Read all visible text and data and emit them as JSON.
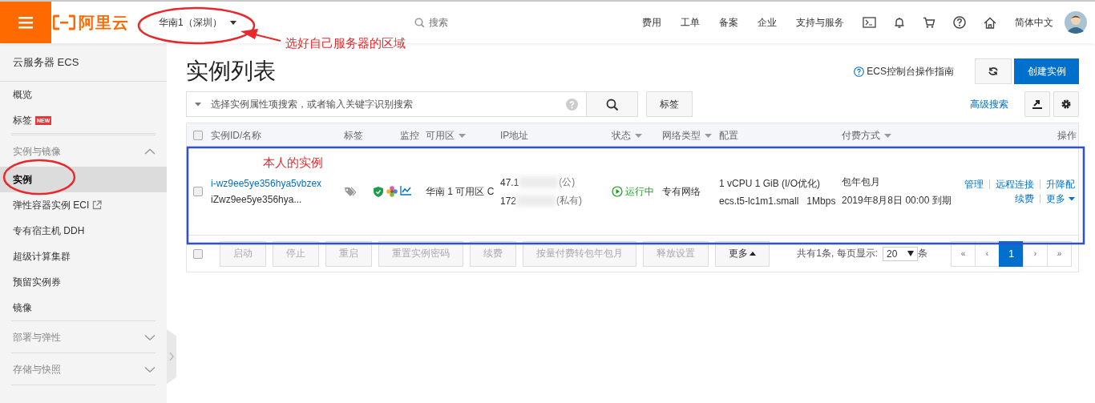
{
  "top_bar": {
    "logo_text": "阿里云",
    "region": "华南1（深圳）",
    "search_placeholder": "搜索",
    "nav_links": [
      "费用",
      "工单",
      "备案",
      "企业",
      "支持与服务"
    ],
    "language": "简体中文"
  },
  "sidebar": {
    "title": "云服务器 ECS",
    "items": [
      {
        "kind": "link",
        "label": "概览",
        "selected": false
      },
      {
        "kind": "link",
        "label": "标签",
        "selected": false,
        "badge": "NEW"
      },
      {
        "kind": "group",
        "label": "实例与镜像",
        "expanded": true
      },
      {
        "kind": "link",
        "label": "实例",
        "selected": true
      },
      {
        "kind": "link",
        "label": "弹性容器实例 ECI",
        "selected": false,
        "external": true
      },
      {
        "kind": "link",
        "label": "专有宿主机 DDH",
        "selected": false
      },
      {
        "kind": "link",
        "label": "超级计算集群",
        "selected": false
      },
      {
        "kind": "link",
        "label": "预留实例券",
        "selected": false
      },
      {
        "kind": "link",
        "label": "镜像",
        "selected": false
      },
      {
        "kind": "group",
        "label": "部署与弹性",
        "expanded": false
      },
      {
        "kind": "group",
        "label": "存储与快照",
        "expanded": false
      }
    ]
  },
  "page": {
    "title": "实例列表",
    "guide_link": "ECS控制台操作指南",
    "create_button": "创建实例"
  },
  "filter": {
    "placeholder": "选择实例属性项搜索，或者输入关键字识别搜索",
    "tag_button": "标签",
    "advanced_search": "高级搜索"
  },
  "table": {
    "all_selected": false,
    "columns": [
      {
        "label": "实例ID/名称",
        "dropdown": false
      },
      {
        "label": "标签",
        "dropdown": false
      },
      {
        "label": "监控",
        "dropdown": false
      },
      {
        "label": "可用区",
        "dropdown": true
      },
      {
        "label": "IP地址",
        "dropdown": false
      },
      {
        "label": "状态",
        "dropdown": true
      },
      {
        "label": "网络类型",
        "dropdown": true
      },
      {
        "label": "配置",
        "dropdown": false
      },
      {
        "label": "付费方式",
        "dropdown": true
      },
      {
        "label": "操作",
        "dropdown": false
      }
    ],
    "rows": [
      {
        "selected": false,
        "instance_id": "i-wz9ee5ye356hya5vbzex",
        "instance_name": "iZwz9ee5ye356hya...",
        "zone": "华南 1 可用区 C",
        "public_ip": "47.1",
        "public_ip_suffix": "(公)",
        "private_ip": "172",
        "private_ip_suffix": "(私有)",
        "status": "运行中",
        "network": "专有网络",
        "config": "1 vCPU 1 GiB (I/O优化)",
        "instance_type": "ecs.t5-lc1m1.small",
        "bandwidth": "1Mbps",
        "billing": "包年包月",
        "expiry": "2019年8月8日 00:00 到期",
        "actions": [
          [
            "管理",
            "远程连接",
            "升降配"
          ],
          [
            "续费",
            "更多"
          ]
        ]
      }
    ]
  },
  "footer": {
    "all_selected": false,
    "batch_actions": [
      {
        "label": "启动",
        "disabled": true
      },
      {
        "label": "停止",
        "disabled": true
      },
      {
        "label": "重启",
        "disabled": true
      },
      {
        "label": "重置实例密码",
        "disabled": true
      },
      {
        "label": "续费",
        "disabled": true
      },
      {
        "label": "按量付费转包年包月",
        "disabled": true
      },
      {
        "label": "释放设置",
        "disabled": true
      },
      {
        "label": "更多",
        "disabled": false
      }
    ],
    "total_text": "共有1条, 每页显示:",
    "page_size": "20",
    "page_size_unit": "条",
    "pages": [
      {
        "label": "«",
        "selected": false
      },
      {
        "label": "‹",
        "selected": false
      },
      {
        "label": "1",
        "selected": true
      },
      {
        "label": "›",
        "selected": false
      },
      {
        "label": "»",
        "selected": false
      }
    ]
  },
  "annotations": {
    "region_note": "选好自己服务器的区域",
    "instance_note": "本人的实例"
  }
}
